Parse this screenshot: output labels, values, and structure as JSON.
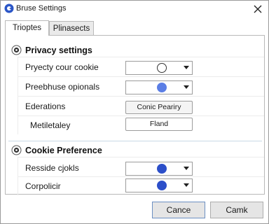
{
  "window": {
    "title": "Bruse Settings"
  },
  "tabs": [
    {
      "label": "Trioptes",
      "active": true
    },
    {
      "label": "Plinasects",
      "active": false
    }
  ],
  "sections": [
    {
      "title": "Privacy settings",
      "icon": "gear-icon",
      "rows": [
        {
          "label": "Pryecty cour cookie",
          "control": "select",
          "swatch_color": "#ffffff"
        },
        {
          "label": "Preebhuse opionals",
          "control": "select",
          "swatch_color": "#5b7ee5"
        },
        {
          "label": "Ederations",
          "control": "button",
          "button_label": "Conic Peariry"
        },
        {
          "label": "Metiletaley",
          "control": "button",
          "button_label": "Fland"
        }
      ]
    },
    {
      "title": "Cookie Preference",
      "icon": "gear-icon",
      "rows": [
        {
          "label": "Resside cjokls",
          "control": "select",
          "swatch_color": "#2c4fc9"
        },
        {
          "label": "Corpolicir",
          "control": "select",
          "swatch_color": "#2c4fc9"
        }
      ]
    }
  ],
  "footer": {
    "cancel_label": "Cance",
    "confirm_label": "Camk"
  },
  "colors": {
    "accent": "#2c4fc9",
    "divider": "#c9d8e6"
  }
}
